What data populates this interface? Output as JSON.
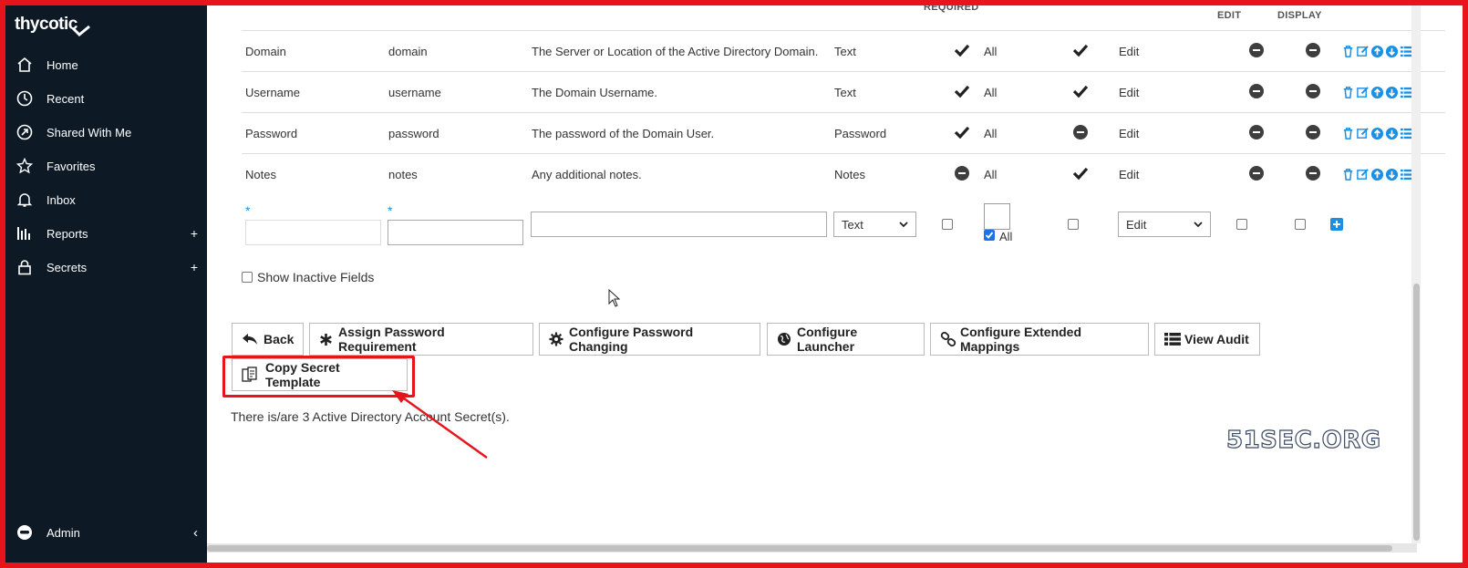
{
  "app": {
    "logo": "thycotic"
  },
  "sidebar": {
    "items": [
      {
        "label": "Home",
        "icon": "home-icon"
      },
      {
        "label": "Recent",
        "icon": "clock-icon"
      },
      {
        "label": "Shared With Me",
        "icon": "share-icon"
      },
      {
        "label": "Favorites",
        "icon": "star-icon"
      },
      {
        "label": "Inbox",
        "icon": "bell-icon"
      },
      {
        "label": "Reports",
        "icon": "bar-chart-icon",
        "expand": "+"
      },
      {
        "label": "Secrets",
        "icon": "lock-icon",
        "expand": "+"
      }
    ],
    "user": {
      "label": "Admin",
      "chevron": "‹"
    }
  },
  "table": {
    "headers": {
      "required": "REQUIRED",
      "edit": "EDIT",
      "display": "DISPLAY"
    },
    "rows": [
      {
        "name": "Domain",
        "slug": "domain",
        "description": "The Server or Location of the Active Directory Domain.",
        "type": "Text",
        "required": "check",
        "access": "All",
        "searchable": "check",
        "editable": "Edit"
      },
      {
        "name": "Username",
        "slug": "username",
        "description": "The Domain Username.",
        "type": "Text",
        "required": "check",
        "access": "All",
        "searchable": "check",
        "editable": "Edit"
      },
      {
        "name": "Password",
        "slug": "password",
        "description": "The password of the Domain User.",
        "type": "Password",
        "required": "check",
        "access": "All",
        "searchable": "minus",
        "editable": "Edit"
      },
      {
        "name": "Notes",
        "slug": "notes",
        "description": "Any additional notes.",
        "type": "Notes",
        "required": "minus",
        "access": "All",
        "searchable": "check",
        "editable": "Edit"
      }
    ],
    "new_row": {
      "star": "*",
      "name_value": "",
      "slug_value": "",
      "description_value": "",
      "type_selected": "Text",
      "all_label": "All",
      "edit_selected": "Edit"
    }
  },
  "show_inactive_label": "Show Inactive Fields",
  "buttons": {
    "back": "Back",
    "assign_password_requirement": "Assign Password Requirement",
    "configure_password_changing": "Configure Password Changing",
    "configure_launcher": "Configure Launcher",
    "configure_extended_mappings": "Configure Extended Mappings",
    "view_audit": "View Audit",
    "copy_secret_template": "Copy Secret Template"
  },
  "status_text": "There is/are 3 Active Directory Account Secret(s).",
  "watermark": "51SEC.ORG",
  "colors": {
    "sidebar_bg": "#0e1926",
    "highlight": "#e8141c",
    "action_blue": "#1a8fe3"
  }
}
